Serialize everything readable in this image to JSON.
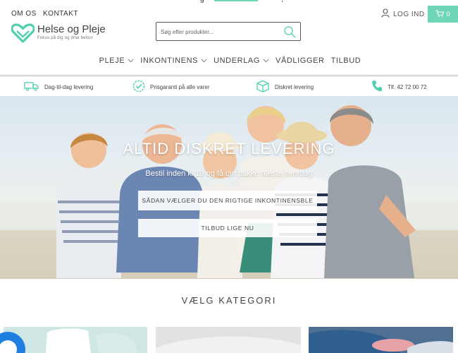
{
  "topbar": {
    "about_label": "OM OS",
    "contact_label": "KONTAKT",
    "login_label": "LOG IND",
    "cart_count": "0",
    "partial_text": "g",
    "partial_text_right": ","
  },
  "logo": {
    "name": "Helse og Pleje",
    "tagline": "Fokus på dig og dine behov"
  },
  "search": {
    "placeholder": "Søg efter produkter..."
  },
  "nav": {
    "items": [
      {
        "label": "PLEJE",
        "has_dropdown": true
      },
      {
        "label": "INKONTINENS",
        "has_dropdown": true
      },
      {
        "label": "UNDERLAG",
        "has_dropdown": true
      },
      {
        "label": "VÅDLIGGER",
        "has_dropdown": false
      },
      {
        "label": "TILBUD",
        "has_dropdown": false
      }
    ]
  },
  "usp": {
    "delivery": "Dag-til-dag levering",
    "price": "Prisgaranti på alle varer",
    "discreet": "Diskret levering",
    "phone": "Tlf. 42 72 00 72"
  },
  "hero": {
    "title": "ALTID DISKRET LEVERING",
    "subtitle": "Bestil inden kl 13 og få din pakke næste hverdag",
    "button_primary": "SÅDAN VÆLGER DU DEN RIGTIGE INKONTINENSBLE",
    "button_secondary": "TILBUD LIGE NU"
  },
  "category": {
    "title": "VÆLG KATEGORI"
  },
  "colors": {
    "accent": "#6fd6b9",
    "cart_bg": "#6fd6b9",
    "text": "#444444",
    "chat_bubble": "#1f7fe0"
  }
}
